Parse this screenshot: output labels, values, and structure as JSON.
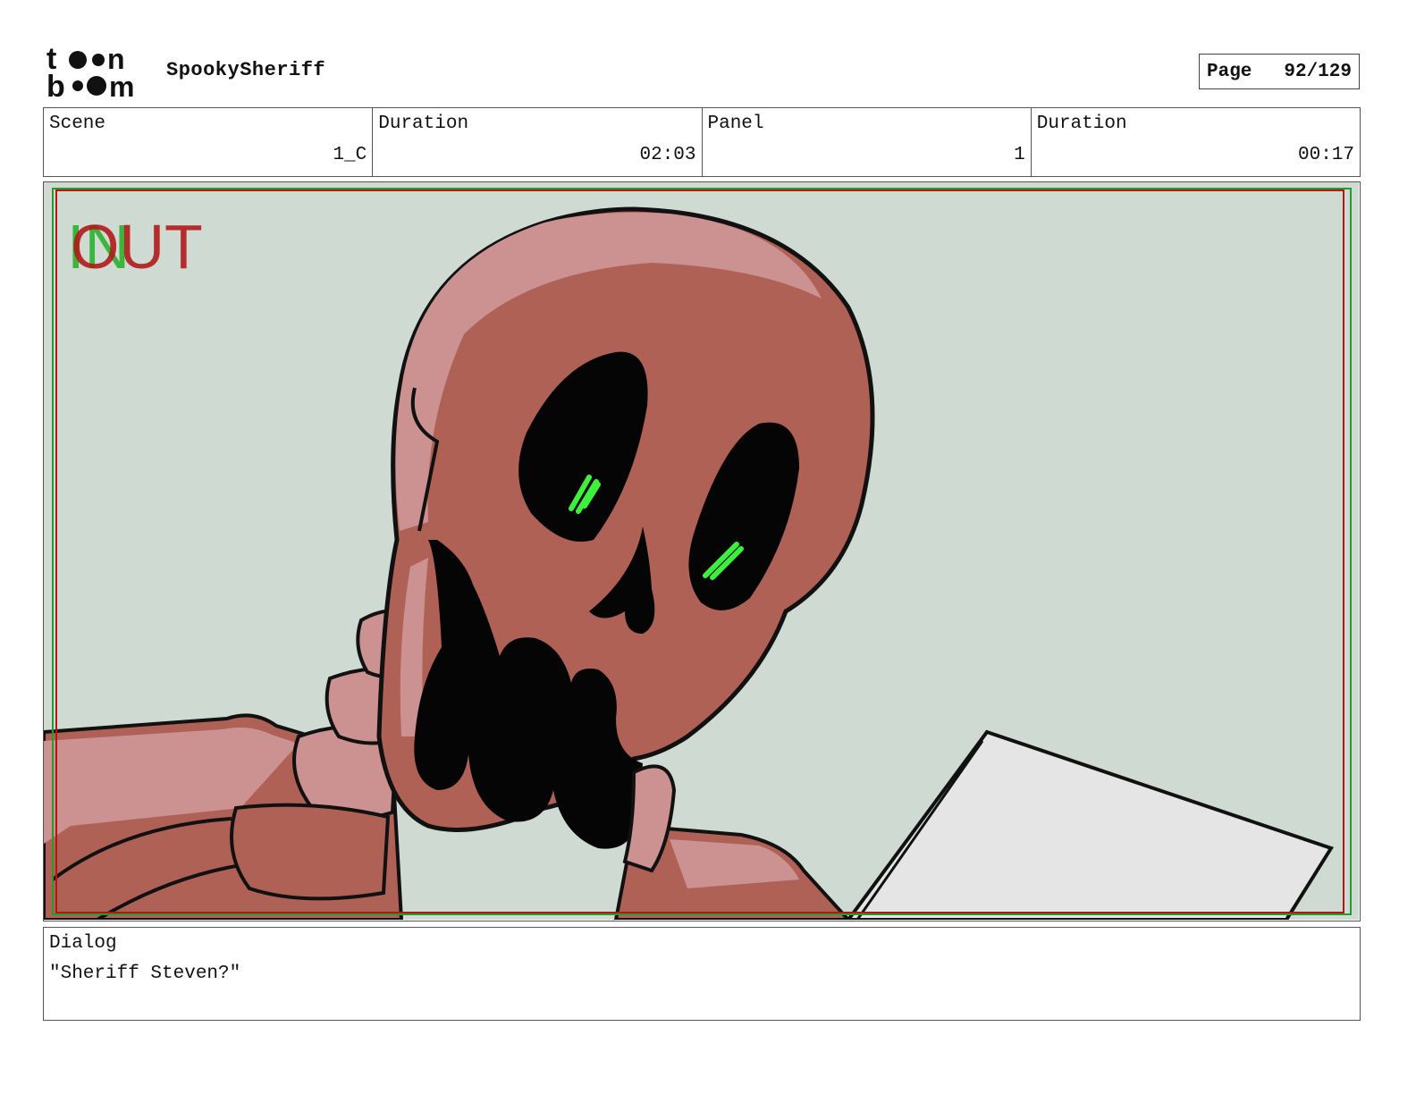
{
  "header": {
    "project": "SpookySheriff",
    "page_label": "Page",
    "page_value": "92/129"
  },
  "info": [
    {
      "label": "Scene",
      "value": "1_C"
    },
    {
      "label": "Duration",
      "value": "02:03"
    },
    {
      "label": "Panel",
      "value": "1"
    },
    {
      "label": "Duration",
      "value": "00:17"
    }
  ],
  "panel": {
    "in_mark": "IN",
    "out_mark": "OUT",
    "colors": {
      "background": "#cfdad3",
      "skin": "#b06156",
      "skin_light": "#cc9191",
      "eyes_glow": "#3ef03e",
      "paper": "#e5e5e5",
      "safe_frame_red": "#b01818",
      "safe_frame_green": "#2a9a2a"
    }
  },
  "dialog": {
    "label": "Dialog",
    "text": "\"Sheriff Steven?\""
  }
}
